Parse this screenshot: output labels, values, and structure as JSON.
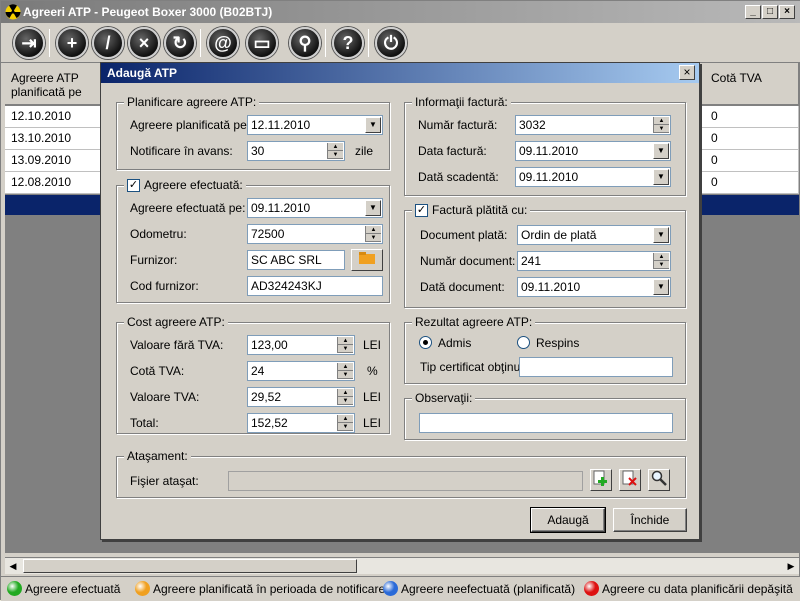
{
  "window": {
    "title": "Agreeri ATP - Peugeot Boxer 3000 (B02BTJ)"
  },
  "titlebar_buttons": [
    "_",
    "□",
    "×"
  ],
  "toolbar": [
    {
      "name": "exit-icon",
      "glyph": "⇥"
    },
    {
      "name": "add-icon",
      "glyph": "+"
    },
    {
      "name": "edit-icon",
      "glyph": "/"
    },
    {
      "name": "delete-icon",
      "glyph": "×"
    },
    {
      "name": "refresh-icon",
      "glyph": "↻"
    },
    {
      "name": "email-icon",
      "glyph": "@"
    },
    {
      "name": "print-icon",
      "glyph": "▭"
    },
    {
      "name": "search-icon",
      "glyph": "⚲"
    },
    {
      "name": "help-icon",
      "glyph": "?"
    },
    {
      "name": "power-icon",
      "glyph": "⏻"
    }
  ],
  "grid": {
    "headers": {
      "col1": "Agreere ATP planificată pe",
      "col2": "Cotă TVA"
    },
    "rows": [
      {
        "date": "12.10.2010",
        "vat": "0"
      },
      {
        "date": "13.10.2010",
        "vat": "0"
      },
      {
        "date": "13.09.2010",
        "vat": "0"
      },
      {
        "date": "12.08.2010",
        "vat": "0"
      }
    ]
  },
  "status_legend": [
    {
      "label": "Agreere efectuată",
      "color": "#22aa22"
    },
    {
      "label": "Agreere planificată în perioada de notificare",
      "color": "#f0a020"
    },
    {
      "label": "Agreere neefectuată (planificată)",
      "color": "#2a6ad8"
    },
    {
      "label": "Agreere cu data planificării depăşită",
      "color": "#dd1111"
    }
  ],
  "dialog": {
    "title": "Adaugă ATP",
    "close_glyph": "×",
    "planning": {
      "group_title": "Planificare agreere ATP:",
      "planned_label": "Agreere planificată pe:",
      "planned_value": "12.11.2010",
      "notify_label": "Notificare în avans:",
      "notify_value": "30",
      "notify_unit": "zile"
    },
    "done": {
      "group_title": "Agreere efectuată:",
      "checked": true,
      "done_label": "Agreere efectuată pe:",
      "done_value": "09.11.2010",
      "odometer_label": "Odometru:",
      "odometer_value": "72500",
      "supplier_label": "Furnizor:",
      "supplier_value": "SC ABC SRL",
      "supplier_code_label": "Cod furnizor:",
      "supplier_code_value": "AD324243KJ"
    },
    "cost": {
      "group_title": "Cost agreere ATP:",
      "rows": [
        {
          "label": "Valoare fără TVA:",
          "value": "123,00",
          "unit": "LEI"
        },
        {
          "label": "Cotă TVA:",
          "value": "24",
          "unit": "%"
        },
        {
          "label": "Valoare TVA:",
          "value": "29,52",
          "unit": "LEI"
        },
        {
          "label": "Total:",
          "value": "152,52",
          "unit": "LEI"
        }
      ]
    },
    "invoice": {
      "group_title": "Informaţii factură:",
      "number_label": "Număr factură:",
      "number_value": "3032",
      "date_label": "Data factură:",
      "date_value": "09.11.2010",
      "due_label": "Dată scadentă:",
      "due_value": "09.11.2010"
    },
    "paid": {
      "group_title": "Factură plătită cu:",
      "checked": true,
      "doc_label": "Document plată:",
      "doc_value": "Ordin de plată",
      "docnum_label": "Număr document:",
      "docnum_value": "241",
      "docdate_label": "Dată document:",
      "docdate_value": "09.11.2010"
    },
    "result": {
      "group_title": "Rezultat agreere ATP:",
      "option_pass": "Admis",
      "option_fail": "Respins",
      "selected": "Admis",
      "cert_label": "Tip certificat obţinut:",
      "cert_value": ""
    },
    "notes": {
      "group_title": "Observaţii:",
      "value": ""
    },
    "attachment": {
      "group_title": "Ataşament:",
      "file_label": "Fişier ataşat:",
      "file_value": ""
    },
    "buttons": {
      "add": "Adaugă",
      "close": "Închide"
    }
  }
}
